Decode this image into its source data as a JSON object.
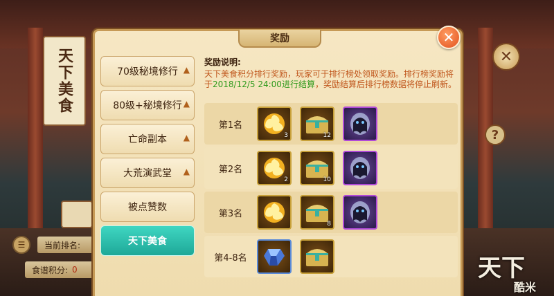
{
  "background": {
    "banner_text": "天下美食",
    "watermark_big": "天下",
    "watermark_small": "酷米"
  },
  "player": {
    "rank_label": "当前排名:",
    "score_label": "食谱积分:",
    "score_value": "0"
  },
  "modal": {
    "title": "奖励",
    "tabs": [
      {
        "label": "70级秘境修行",
        "chevron": true,
        "active": false
      },
      {
        "label": "80级+秘境修行",
        "chevron": true,
        "active": false
      },
      {
        "label": "亡命副本",
        "chevron": true,
        "active": false
      },
      {
        "label": "大荒演武堂",
        "chevron": true,
        "active": false
      },
      {
        "label": "被点赞数",
        "chevron": false,
        "active": false
      },
      {
        "label": "天下美食",
        "chevron": false,
        "active": true
      }
    ],
    "description_title": "奖励说明:",
    "description_part1": "天下美食积分排行奖励，玩家可于排行榜处领取奖励。排行榜奖励将于",
    "description_date": "2018/12/5 24:00进行结算",
    "description_part2": "，奖励结算后排行榜数据将停止刷新。",
    "ranks": [
      {
        "name": "第1名",
        "items": [
          {
            "icon": "gold-spiral-icon",
            "count": "3"
          },
          {
            "icon": "treasure-chest-icon",
            "count": "12"
          },
          {
            "icon": "ghost-spirit-icon",
            "count": ""
          }
        ]
      },
      {
        "name": "第2名",
        "items": [
          {
            "icon": "gold-spiral-icon",
            "count": "2"
          },
          {
            "icon": "treasure-chest-icon",
            "count": "10"
          },
          {
            "icon": "ghost-spirit-icon",
            "count": ""
          }
        ]
      },
      {
        "name": "第3名",
        "items": [
          {
            "icon": "gold-spiral-icon",
            "count": ""
          },
          {
            "icon": "treasure-chest-icon",
            "count": "8"
          },
          {
            "icon": "ghost-spirit-icon",
            "count": ""
          }
        ]
      },
      {
        "name": "第4-8名",
        "items": [
          {
            "icon": "blue-crystal-icon",
            "count": ""
          },
          {
            "icon": "treasure-chest-icon",
            "count": ""
          }
        ]
      }
    ]
  },
  "colors": {
    "accent_active_tab": "#1ea898",
    "highlight_text": "#2f9a1c",
    "description_text": "#c0561c"
  }
}
